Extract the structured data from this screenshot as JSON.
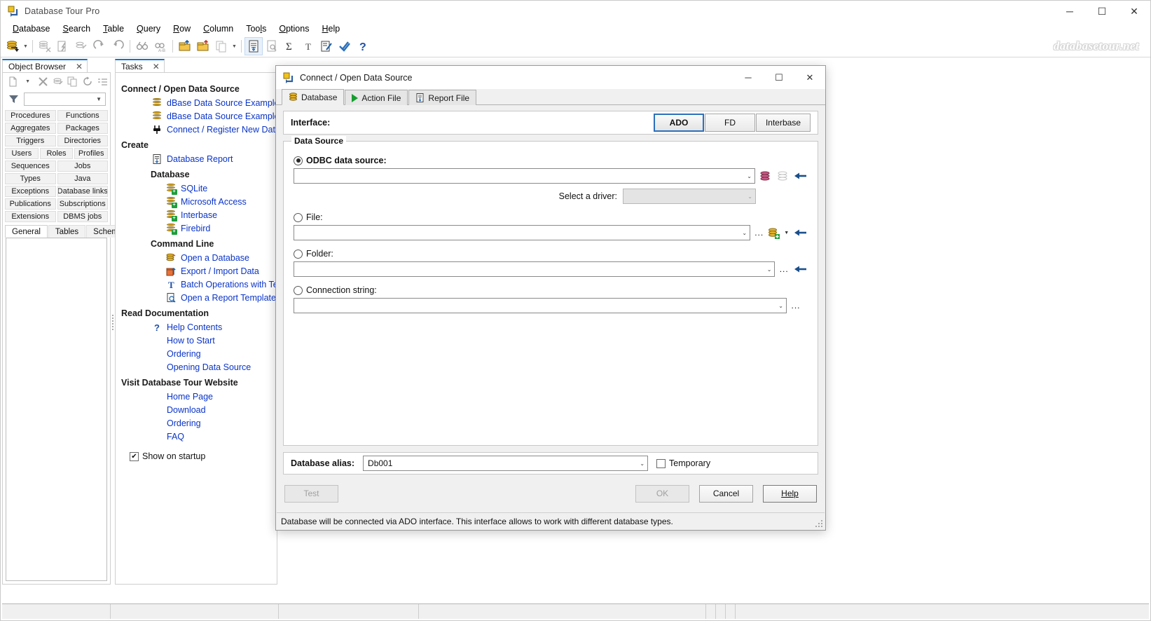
{
  "window": {
    "title": "Database Tour Pro",
    "app_icon": "database-tour-icon",
    "minimize": "─",
    "maximize": "☐",
    "close": "✕",
    "watermark": "databasetour.net"
  },
  "menubar": {
    "items": [
      {
        "label": "Database",
        "accel": "D"
      },
      {
        "label": "Search",
        "accel": "S"
      },
      {
        "label": "Table",
        "accel": "T"
      },
      {
        "label": "Query",
        "accel": "Q"
      },
      {
        "label": "Row",
        "accel": "R"
      },
      {
        "label": "Column",
        "accel": "C"
      },
      {
        "label": "Tools",
        "accel": "l"
      },
      {
        "label": "Options",
        "accel": "O"
      },
      {
        "label": "Help",
        "accel": "H"
      }
    ]
  },
  "toolbar": {
    "buttons": [
      {
        "name": "open-database-icon",
        "glyph": "db"
      },
      {
        "name": "open-database-dropdown-icon",
        "glyph": "caret"
      },
      {
        "name": "close-database-icon",
        "glyph": "db-close"
      },
      {
        "name": "execute-query-icon",
        "glyph": "lightning"
      },
      {
        "name": "edit-query-icon",
        "glyph": "pen"
      },
      {
        "name": "redo-icon",
        "glyph": "redo"
      },
      {
        "name": "undo-icon",
        "glyph": "undo"
      },
      {
        "name": "find-icon",
        "glyph": "binoculars"
      },
      {
        "name": "replace-icon",
        "glyph": "binoculars-ab"
      },
      {
        "name": "import-data-icon",
        "glyph": "import"
      },
      {
        "name": "export-data-icon",
        "glyph": "export"
      },
      {
        "name": "copy-icon",
        "glyph": "copy"
      },
      {
        "name": "copy-dropdown-icon",
        "glyph": "caret"
      },
      {
        "name": "database-report-icon",
        "glyph": "report"
      },
      {
        "name": "report-preview-icon",
        "glyph": "preview"
      },
      {
        "name": "sum-icon",
        "glyph": "sigma"
      },
      {
        "name": "text-icon",
        "glyph": "T"
      },
      {
        "name": "script-icon",
        "glyph": "script"
      },
      {
        "name": "check-icon",
        "glyph": "check"
      },
      {
        "name": "help-icon",
        "glyph": "question"
      }
    ]
  },
  "object_browser": {
    "tab_title": "Object Browser",
    "close_glyph": "✕",
    "toolbar_icons": [
      "new-object-icon",
      "new-object-dropdown-icon",
      "delete-object-icon",
      "refresh-object-icon",
      "copy-object-icon",
      "reload-icon",
      "list-icon"
    ],
    "filter_icon": "filter-icon",
    "filter_value": "",
    "categories": [
      [
        "Procedures",
        "Functions"
      ],
      [
        "Aggregates",
        "Packages"
      ],
      [
        "Triggers",
        "Directories"
      ],
      [
        "Users",
        "Roles",
        "Profiles"
      ],
      [
        "Sequences",
        "Jobs"
      ],
      [
        "Types",
        "Java"
      ],
      [
        "Exceptions",
        "Database links"
      ],
      [
        "Publications",
        "Subscriptions"
      ],
      [
        "Extensions",
        "DBMS jobs"
      ]
    ],
    "bottom_tabs": [
      {
        "label": "General",
        "selected": true
      },
      {
        "label": "Tables",
        "selected": false
      },
      {
        "label": "Schemas",
        "selected": false
      }
    ]
  },
  "tasks": {
    "tab_title": "Tasks",
    "close_glyph": "✕",
    "sections": [
      {
        "heading": "Connect / Open Data Source",
        "items": [
          {
            "label": "dBase Data Source Example (ado-odbc)",
            "icon": "database-icon",
            "indent": 0
          },
          {
            "label": "dBase Data Source Example (ado-direct)",
            "icon": "database-icon",
            "indent": 0
          },
          {
            "label": "Connect / Register New Data Source...",
            "icon": "plug-icon",
            "indent": 0
          }
        ]
      },
      {
        "heading": "Create",
        "items": [
          {
            "label": "Database Report",
            "icon": "report-icon",
            "indent": 0
          }
        ],
        "subsections": [
          {
            "heading": "Database",
            "items": [
              {
                "label": "SQLite",
                "icon": "database-add-icon",
                "indent": 1
              },
              {
                "label": "Microsoft Access",
                "icon": "database-add-icon",
                "indent": 1
              },
              {
                "label": "Interbase",
                "icon": "database-add-icon",
                "indent": 1
              },
              {
                "label": "Firebird",
                "icon": "database-add-icon",
                "indent": 1
              }
            ]
          },
          {
            "heading": "Command Line",
            "items": [
              {
                "label": "Open a Database",
                "icon": "database-cmd-icon",
                "indent": 1
              },
              {
                "label": "Export / Import Data",
                "icon": "export-import-icon",
                "indent": 1
              },
              {
                "label": "Batch Operations with Text Fields",
                "icon": "text-field-icon",
                "indent": 1
              },
              {
                "label": "Open a Report Template",
                "icon": "report-template-icon",
                "indent": 1
              }
            ]
          }
        ]
      },
      {
        "heading": "Read Documentation",
        "items": [
          {
            "label": "Help Contents",
            "icon": "help-icon",
            "indent": 0
          },
          {
            "label": "How to Start",
            "icon": "",
            "indent": 0
          },
          {
            "label": "Ordering",
            "icon": "",
            "indent": 0
          },
          {
            "label": "Opening Data Source",
            "icon": "",
            "indent": 0
          }
        ]
      },
      {
        "heading": "Visit Database Tour Website",
        "items": [
          {
            "label": "Home Page",
            "icon": "",
            "indent": 0
          },
          {
            "label": "Download",
            "icon": "",
            "indent": 0
          },
          {
            "label": "Ordering",
            "icon": "",
            "indent": 0
          },
          {
            "label": "FAQ",
            "icon": "",
            "indent": 0
          }
        ]
      }
    ],
    "show_on_startup": {
      "label": "Show on startup",
      "checked": true,
      "check_glyph": "✔"
    }
  },
  "dialog": {
    "title": "Connect / Open Data Source",
    "icon": "database-tour-icon",
    "minimize": "─",
    "maximize": "☐",
    "close": "✕",
    "tabs": [
      {
        "label": "Database",
        "icon": "database-icon",
        "selected": true
      },
      {
        "label": "Action File",
        "icon": "play-icon",
        "selected": false
      },
      {
        "label": "Report File",
        "icon": "report-icon",
        "selected": false
      }
    ],
    "interface": {
      "label": "Interface:",
      "options": [
        {
          "label": "ADO",
          "selected": true
        },
        {
          "label": "FD",
          "selected": false
        },
        {
          "label": "Interbase",
          "selected": false
        }
      ]
    },
    "data_source": {
      "legend": "Data Source",
      "odbc": {
        "label": "ODBC data source:",
        "selected": true,
        "value": "",
        "arrow_glyph": "⌄",
        "buttons": [
          "odbc-admin-icon",
          "odbc-list-icon",
          "apply-arrow-icon"
        ]
      },
      "driver": {
        "label": "Select a driver:",
        "value": "",
        "disabled": true,
        "arrow_glyph": "⌄"
      },
      "file": {
        "label": "File:",
        "selected": false,
        "value": "",
        "arrow_glyph": "⌄",
        "browse_label": "...",
        "buttons": [
          "create-database-icon",
          "create-database-dropdown-icon",
          "apply-arrow-icon"
        ]
      },
      "folder": {
        "label": "Folder:",
        "selected": false,
        "value": "",
        "arrow_glyph": "⌄",
        "browse_label": "...",
        "buttons": [
          "apply-arrow-icon"
        ]
      },
      "connection_string": {
        "label": "Connection string:",
        "selected": false,
        "value": "",
        "arrow_glyph": "⌄",
        "browse_label": "..."
      }
    },
    "alias": {
      "label": "Database alias:",
      "value": "Db001",
      "arrow_glyph": "⌄",
      "temporary": {
        "label": "Temporary",
        "checked": false
      }
    },
    "buttons": {
      "test": {
        "label": "Test",
        "enabled": false
      },
      "ok": {
        "label": "OK",
        "enabled": false
      },
      "cancel": {
        "label": "Cancel",
        "enabled": true
      },
      "help": {
        "label": "Help",
        "enabled": true
      }
    },
    "status": "Database will be connected via ADO interface. This interface allows to work with different database types."
  },
  "colors": {
    "accent": "#0b74d4",
    "link": "#0a34c8",
    "selected_border": "#2c6fbb",
    "panel_bg": "#f0f0f0"
  }
}
